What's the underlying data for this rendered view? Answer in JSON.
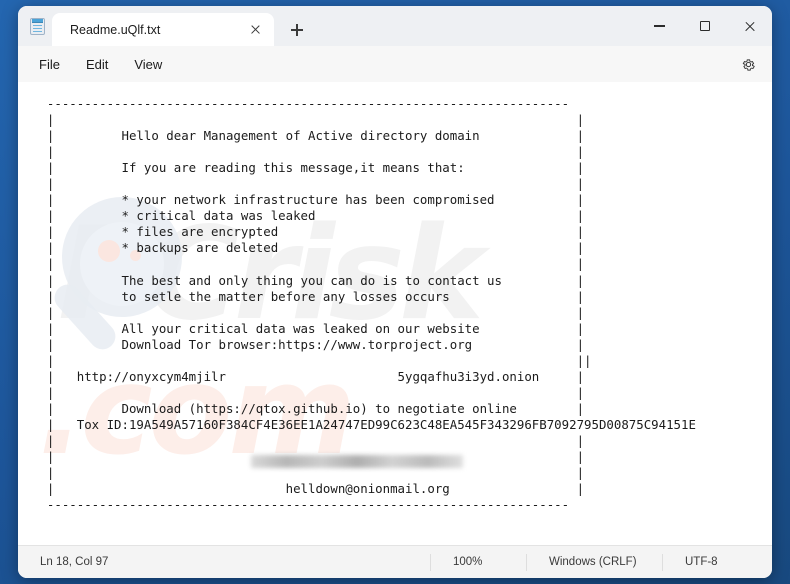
{
  "window": {
    "app_icon": "notepad-icon",
    "controls": {
      "minimize": "minimize-icon",
      "maximize": "maximize-icon",
      "close": "close-icon"
    }
  },
  "tabs": [
    {
      "title": "Readme.uQlf.txt",
      "close_icon": "close-icon",
      "active": true
    }
  ],
  "new_tab_label": "+",
  "menubar": {
    "items": [
      "File",
      "Edit",
      "View"
    ],
    "settings_icon": "gear-icon"
  },
  "watermark": {
    "logo": "magnifier-icon",
    "text": "PCrisk",
    "text2": ".com"
  },
  "document": {
    "text": "  ----------------------------------------------------------------------\n  |                                                                      |\n  |         Hello dear Management of Active directory domain             |\n  |                                                                      |\n  |         If you are reading this message,it means that:               |\n  |                                                                      |\n  |         * your network infrastructure has been compromised           |\n  |         * critical data was leaked                                   |\n  |         * files are encrypted                                        |\n  |         * backups are deleted                                        |\n  |                                                                      |\n  |         The best and only thing you can do is to contact us          |\n  |         to setle the matter before any losses occurs                 |\n  |                                                                      |\n  |         All your critical data was leaked on our website             |\n  |         Download Tor browser:https://www.torproject.org              |\n  |                                                                      ||\n  |   http://onyxcym4mjilr                       5ygqafhu3i3yd.onion     |\n  |                                                                      |\n  |         Download (https://qtox.github.io) to negotiate online        |\n  |   Tox ID:19A549A57160F384CF4E36EE1A24747ED99C623C48EA545F343296FB7092795D00875C94151E\n  |                                                                      |\n  |                                                                      |\n  |                                                                      |\n  |                               helldown@onionmail.org                 |\n  ----------------------------------------------------------------------",
    "onion_url_prefix": "http://onyxcym4mjilr",
    "onion_url_suffix": "5ygqafhu3i3yd.onion",
    "tox_id": "19A549A57160F384CF4E36EE1A24747ED99C623C48EA545F343296FB7092795D00875C94151E",
    "contact_email": "helldown@onionmail.org",
    "tor_browser_url": "https://www.torproject.org",
    "qtox_url": "https://qtox.github.io",
    "redacted_region": "blurred-onion-url-segment"
  },
  "statusbar": {
    "position": "Ln 18, Col 97",
    "zoom": "100%",
    "line_ending": "Windows (CRLF)",
    "encoding": "UTF-8"
  },
  "colors": {
    "desktop": "#1e5ba8",
    "window": "#f7f7f7",
    "editor": "#ffffff",
    "text": "#1b1b1b",
    "watermark_gray": "#f2f2f2",
    "watermark_pink": "#fdeee9"
  }
}
